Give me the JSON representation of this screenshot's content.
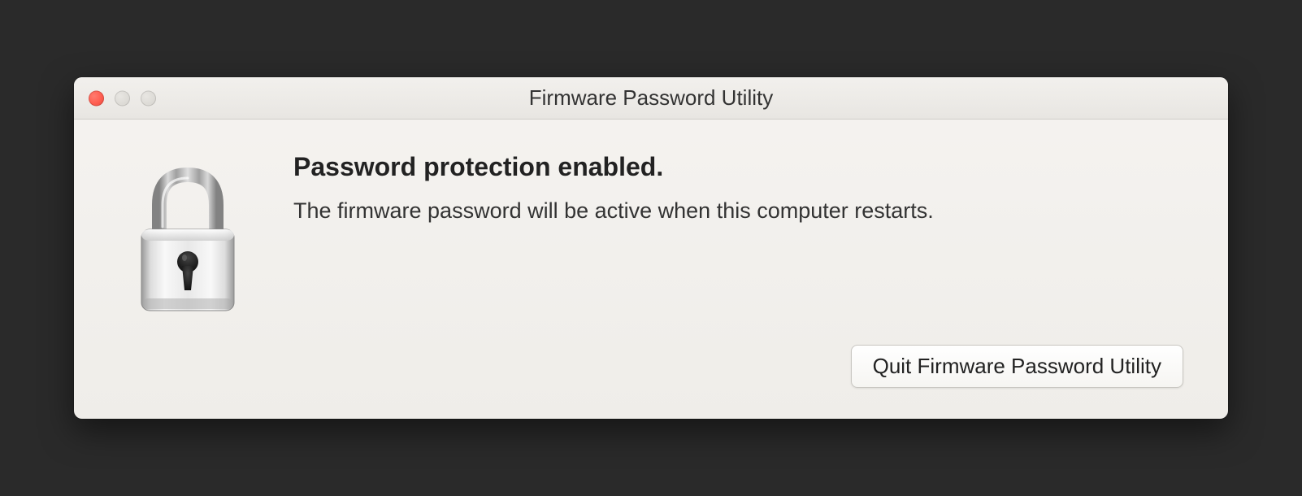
{
  "window": {
    "title": "Firmware Password Utility"
  },
  "content": {
    "heading": "Password protection enabled.",
    "description": "The firmware password will be active when this computer restarts."
  },
  "actions": {
    "quit_label": "Quit Firmware Password Utility"
  }
}
